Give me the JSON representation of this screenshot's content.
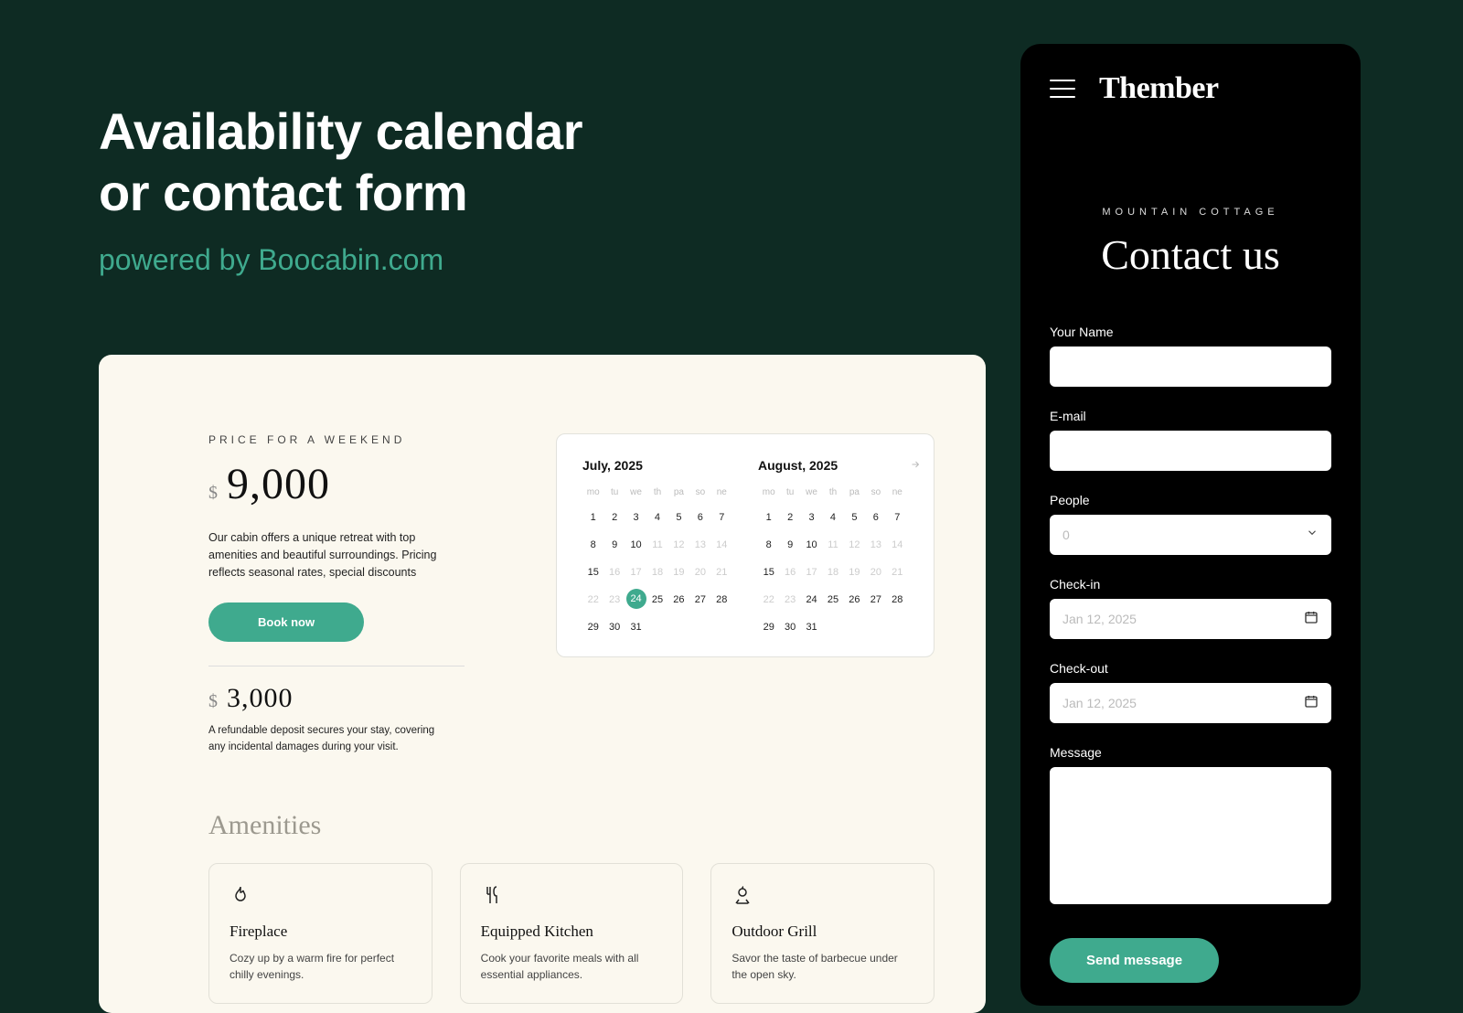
{
  "hero": {
    "line1": "Availability calendar",
    "line2": "or contact form",
    "sub": "powered by Boocabin.com"
  },
  "desktop": {
    "price_label": "PRICE FOR A WEEKEND",
    "currency": "$",
    "price": "9,000",
    "price_desc": "Our cabin offers a unique retreat with top amenities and beautiful surroundings. Pricing reflects seasonal rates, special discounts",
    "book_label": "Book now",
    "deposit": "3,000",
    "deposit_desc": "A refundable deposit secures your stay, covering any incidental damages during your visit.",
    "calendar": {
      "dow": [
        "mo",
        "tu",
        "we",
        "th",
        "pa",
        "so",
        "ne"
      ],
      "selected_day": 24,
      "months": [
        {
          "title": "July, 2025",
          "days": [
            [
              1,
              2,
              3,
              4,
              5,
              6,
              7
            ],
            [
              8,
              9,
              10,
              11,
              12,
              13,
              14
            ],
            [
              15,
              16,
              17,
              18,
              19,
              20,
              21
            ],
            [
              22,
              23,
              24,
              25,
              26,
              27,
              28
            ],
            [
              29,
              30,
              31
            ]
          ],
          "muted": [
            11,
            12,
            13,
            14,
            16,
            17,
            18,
            19,
            20,
            21,
            22,
            23
          ]
        },
        {
          "title": "August, 2025",
          "days": [
            [
              1,
              2,
              3,
              4,
              5,
              6,
              7
            ],
            [
              8,
              9,
              10,
              11,
              12,
              13,
              14
            ],
            [
              15,
              16,
              17,
              18,
              19,
              20,
              21
            ],
            [
              22,
              23,
              24,
              25,
              26,
              27,
              28
            ],
            [
              29,
              30,
              31
            ]
          ],
          "muted": [
            11,
            12,
            13,
            14,
            16,
            17,
            18,
            19,
            20,
            21,
            22,
            23
          ]
        }
      ]
    },
    "amenities_title": "Amenities",
    "amenities": [
      {
        "icon": "fire-icon",
        "name": "Fireplace",
        "desc": "Cozy up by a warm fire for perfect chilly evenings."
      },
      {
        "icon": "utensils-icon",
        "name": "Equipped Kitchen",
        "desc": "Cook your favorite meals with all essential appliances."
      },
      {
        "icon": "grill-icon",
        "name": "Outdoor Grill",
        "desc": "Savor the taste of barbecue under the open sky."
      }
    ]
  },
  "mobile": {
    "brand": "Thember",
    "overline": "MOUNTAIN COTTAGE",
    "title": "Contact us",
    "fields": {
      "name_label": "Your Name",
      "email_label": "E-mail",
      "people_label": "People",
      "people_placeholder": "0",
      "checkin_label": "Check-in",
      "checkin_placeholder": "Jan 12, 2025",
      "checkout_label": "Check-out",
      "checkout_placeholder": "Jan 12, 2025",
      "message_label": "Message"
    },
    "send_label": "Send message"
  }
}
